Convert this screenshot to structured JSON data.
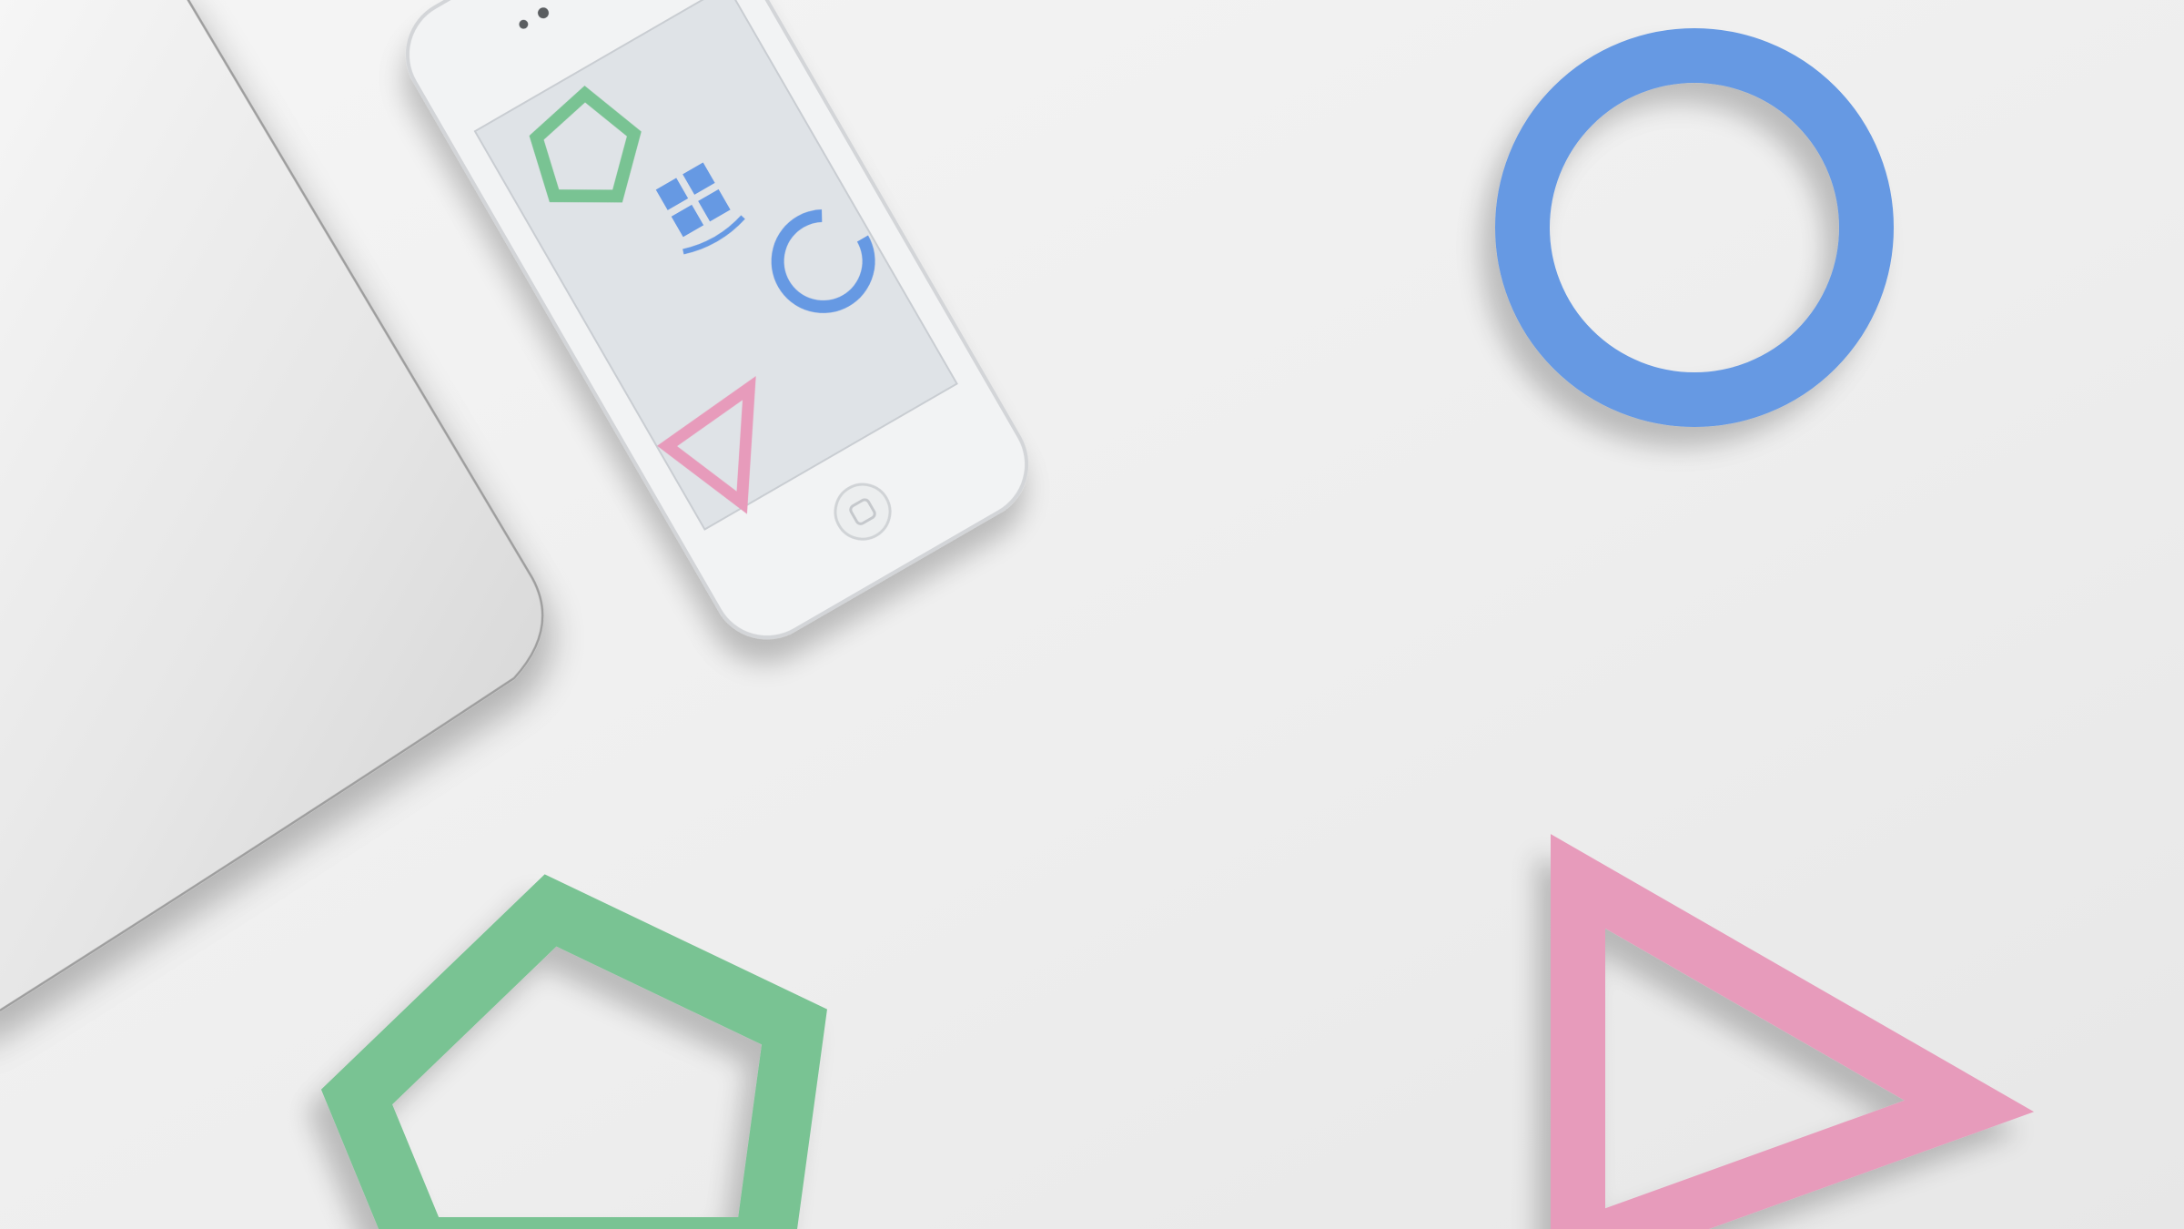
{
  "scene": {
    "background_color": "#eeeeee",
    "objects": [
      {
        "kind": "laptop",
        "color": "#e9e9e9",
        "edge_color": "#b9b9b9"
      },
      {
        "kind": "smartphone",
        "body_color": "#f2f3f4",
        "screen_color": "#dfe3e7"
      },
      {
        "kind": "ring",
        "color": "#6699e3"
      },
      {
        "kind": "triangle-outline",
        "color": "#e79bbb"
      },
      {
        "kind": "pentagon-outline",
        "color": "#79c393"
      }
    ],
    "phone_screen_icons": [
      "pentagon-icon",
      "window-tile-icon",
      "ring-icon",
      "triangle-icon"
    ]
  }
}
